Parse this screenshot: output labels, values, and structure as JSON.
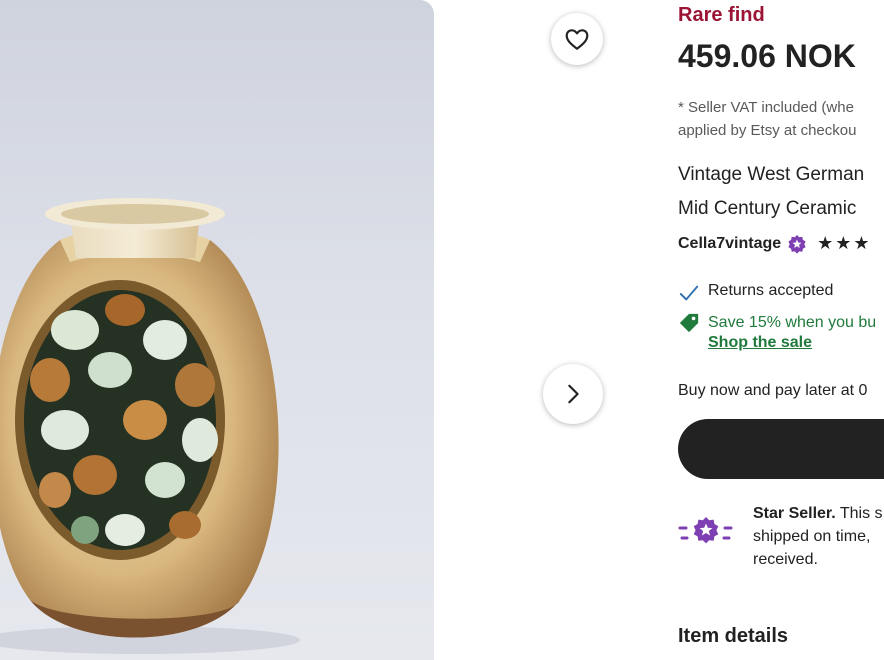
{
  "listing": {
    "rare_find": "Rare find",
    "price": "459.06 NOK",
    "vat_line1": "* Seller VAT included (whe",
    "vat_line2": "applied by Etsy at checkou",
    "title_line1": "Vintage West German",
    "title_line2": "Mid Century Ceramic"
  },
  "seller": {
    "name": "Cella7vintage",
    "stars": "★★★",
    "badge_icon": "star-seller-badge-icon"
  },
  "features": {
    "returns": "Returns accepted",
    "sale_text": "Save 15% when you bu",
    "sale_link": "Shop the sale"
  },
  "purchase": {
    "bnpl": "Buy now and pay later at 0"
  },
  "star_seller": {
    "bold": "Star Seller.",
    "line1_rest": " This s",
    "line2": "shipped on time,",
    "line3": "received."
  },
  "section": {
    "item_details": "Item details"
  },
  "colors": {
    "rare": "#9b1335",
    "sale": "#1f7a3b",
    "star_seller": "#7e3fb2",
    "check": "#2b6cb0"
  },
  "icons": {
    "favorite": "heart-icon",
    "next": "chevron-right-icon",
    "returns": "checkmark-icon",
    "sale": "tag-icon"
  }
}
